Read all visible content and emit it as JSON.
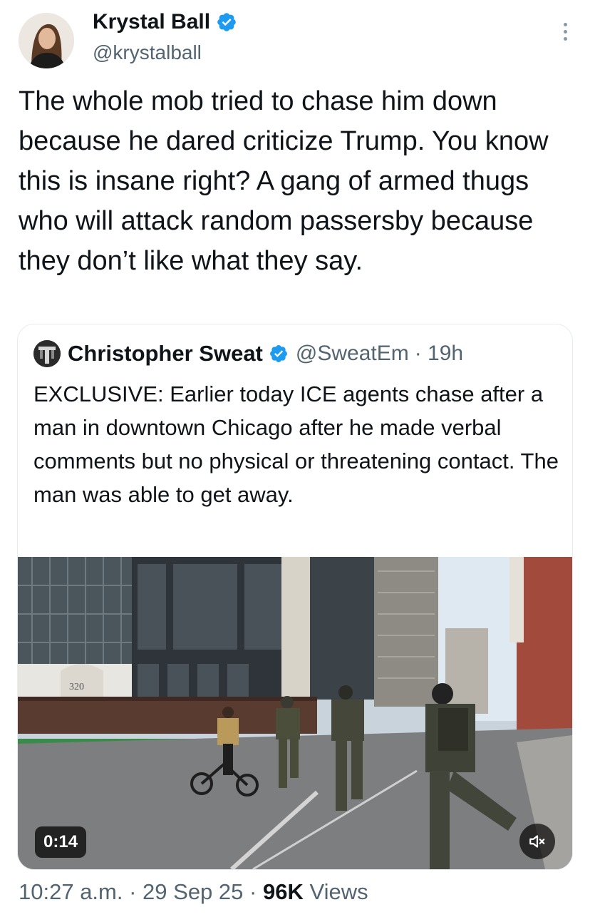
{
  "author": {
    "name": "Krystal Ball",
    "handle": "@krystalball"
  },
  "tweet": {
    "text": "The whole mob tried to chase him down because he dared criticize Trump. You know this is insane right? A gang of armed thugs who will attack random passersby because they don’t like what they say."
  },
  "quoted_tweet": {
    "author_name": "Christopher Sweat",
    "handle": "@SweatEm",
    "time": "· 19h",
    "text": "EXCLUSIVE: Earlier today ICE agents chase after a man in downtown Chicago after he made verbal comments but no physical or threatening contact. The man was able to get away.",
    "media": {
      "type": "video",
      "duration": "0:14",
      "sign_text": "320"
    }
  },
  "meta": {
    "time": "10:27 a.m.",
    "sep1": " · ",
    "date": "29 Sep 25",
    "sep2": " · ",
    "views_count": "96K",
    "views_label": " Views"
  },
  "colors": {
    "verified": "#1d9bf0",
    "secondary_text": "#536471"
  },
  "icons": [
    "verified-badge-icon",
    "more-options-icon",
    "mute-icon"
  ]
}
